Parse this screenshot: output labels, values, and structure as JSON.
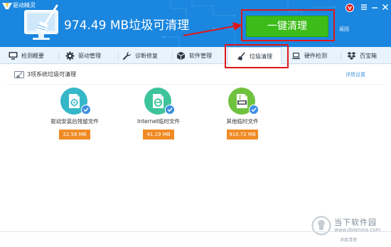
{
  "app": {
    "title": "驱动精灵"
  },
  "header": {
    "summary": "974.49 MB垃圾可清理",
    "clean_button": "一键清理",
    "back_link": "返回"
  },
  "tabs": [
    {
      "label": "检测概要",
      "icon": "monitor-icon"
    },
    {
      "label": "驱动管理",
      "icon": "gear-icon"
    },
    {
      "label": "诊断修复",
      "icon": "wrench-icon"
    },
    {
      "label": "软件管理",
      "icon": "package-icon"
    },
    {
      "label": "垃圾清理",
      "icon": "broom-icon",
      "active": true
    },
    {
      "label": "硬件检测",
      "icon": "laptop-icon"
    },
    {
      "label": "百宝箱",
      "icon": "dropbox-icon"
    }
  ],
  "section": {
    "title": "3项系统垃圾可清理",
    "details_link": "详情设置"
  },
  "items": [
    {
      "label": "驱动安装后残留文件",
      "size": "22.58 MB",
      "icon": "driver-file-icon",
      "color": "#35b7c8"
    },
    {
      "label": "Internet临时文件",
      "size": "41.19 MB",
      "icon": "browser-file-icon",
      "color": "#3ec49a"
    },
    {
      "label": "其他临时文件",
      "size": "910.72 MB",
      "icon": "zip-file-icon",
      "color": "#6fc23e"
    }
  ],
  "footer": {
    "text": "深度清理"
  },
  "watermark": {
    "title": "当下软件园",
    "url": "www.downxia.com"
  },
  "colors": {
    "header_blue": "#1a86df",
    "clean_green": "#3cbc18",
    "highlight_red": "#e0171a",
    "size_orange": "#f08a24",
    "check_blue": "#3c8de0"
  }
}
